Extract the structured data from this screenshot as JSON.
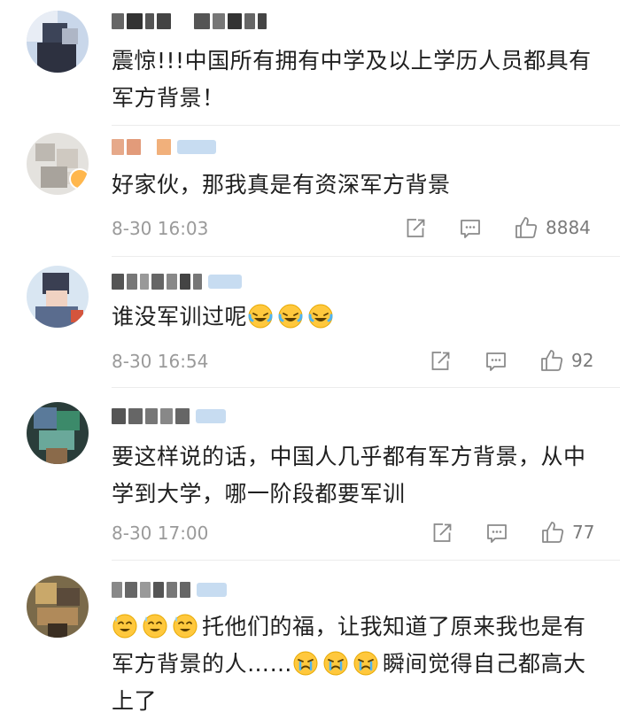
{
  "comments": [
    {
      "text": "震惊!!!中国所有拥有中学及以上学历人员都具有军方背景！"
    },
    {
      "text": "好家伙，那我真是有资深军方背景",
      "time": "8-30 16:03",
      "likes": "8884"
    },
    {
      "text": "谁没军训过呢",
      "time": "8-30 16:54",
      "likes": "92"
    },
    {
      "text": "要这样说的话，中国人几乎都有军方背景，从中学到大学，哪一阶段都要军训",
      "time": "8-30 17:00",
      "likes": "77"
    },
    {
      "text_part1": "托他们的福，让我知道了原来我也是有军方背景的人……",
      "text_part2": "瞬间觉得自己都高大上了"
    }
  ],
  "icons": {
    "share": "share-icon",
    "comment": "comment-icon",
    "like": "like-icon",
    "cry_laugh": "laughing-crying-emoji",
    "sweat_laugh": "sweat-smile-emoji",
    "crying": "crying-emoji"
  },
  "colors": {
    "text": "#1f1f1f",
    "meta": "#9a9a9a",
    "divider": "#ececec",
    "emoji": "#ffc83d"
  }
}
